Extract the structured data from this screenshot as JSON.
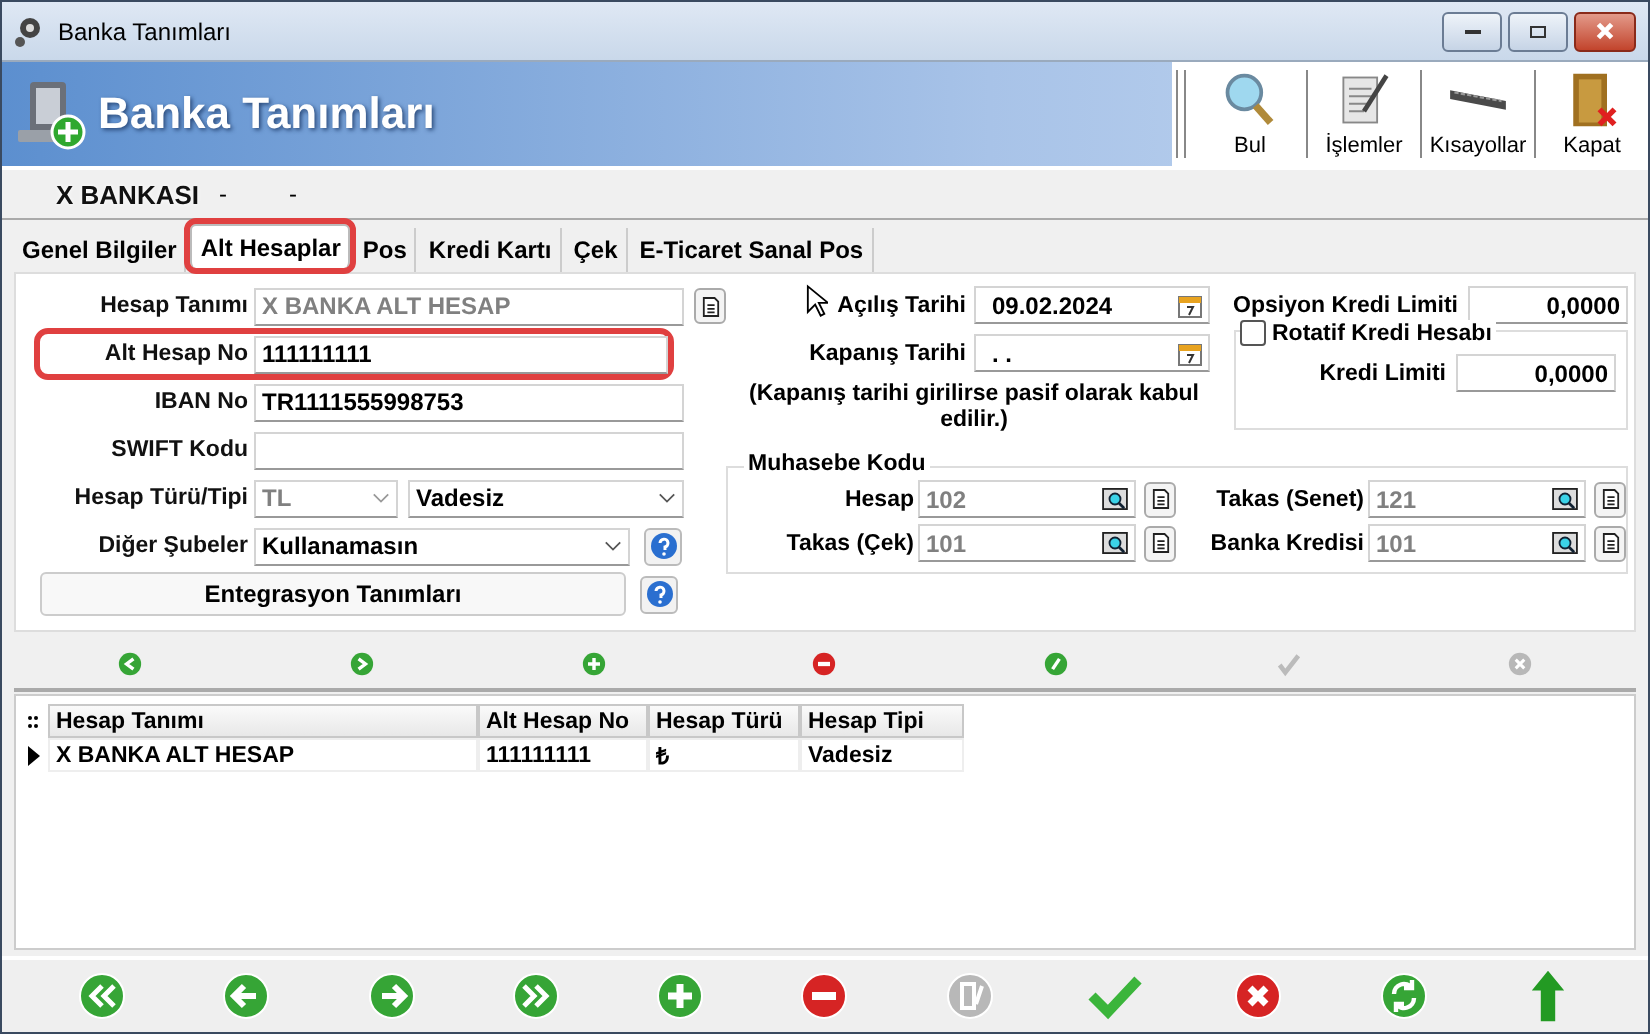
{
  "window": {
    "title": "Banka Tanımları"
  },
  "header": {
    "title": "Banka Tanımları",
    "tools": [
      {
        "kind": "search",
        "label": "Bul"
      },
      {
        "kind": "document",
        "label": "İşlemler"
      },
      {
        "kind": "keyboard",
        "label": "Kısayollar"
      },
      {
        "kind": "door",
        "label": "Kapat"
      }
    ]
  },
  "record": {
    "name": "X BANKASI",
    "field_2": "-",
    "field_3": "-"
  },
  "tabs": [
    {
      "label": "Genel Bilgiler",
      "selected": false,
      "highlighted": false
    },
    {
      "label": "Alt Hesaplar",
      "selected": true,
      "highlighted": true
    },
    {
      "label": "Pos",
      "selected": false,
      "highlighted": false
    },
    {
      "label": "Kredi Kartı",
      "selected": false,
      "highlighted": false
    },
    {
      "label": "Çek",
      "selected": false,
      "highlighted": false
    },
    {
      "label": "E-Ticaret Sanal Pos",
      "selected": false,
      "highlighted": false
    }
  ],
  "left_fields": [
    {
      "kind": "text",
      "label": "Hesap Tanımı",
      "value": "X BANKA ALT HESAP",
      "readonly": true,
      "doc_button": true,
      "highlighted": false
    },
    {
      "kind": "text",
      "label": "Alt Hesap No",
      "value": "111111111",
      "readonly": false,
      "doc_button": false,
      "highlighted": true
    },
    {
      "kind": "text",
      "label": "IBAN No",
      "value": "TR1111555998753",
      "readonly": false,
      "doc_button": false,
      "highlighted": false
    },
    {
      "kind": "text",
      "label": "SWIFT Kodu",
      "doc_button": false,
      "highlighted": false
    },
    {
      "kind": "pair",
      "label": "Hesap Türü/Tipi",
      "value": "TL",
      "value_2": "Vadesiz",
      "readonly": true
    },
    {
      "kind": "select",
      "label": "Diğer Şubeler",
      "value": "Kullanamasın"
    },
    {
      "kind": "button",
      "label": "Entegrasyon Tanımları"
    }
  ],
  "dates": [
    {
      "label": "Açılış Tarihi",
      "value": "09.02.2024"
    },
    {
      "label": "Kapanış Tarihi",
      "value": ". ."
    }
  ],
  "date_note": "(Kapanış tarihi girilirse pasif olarak kabul edilir.)",
  "credit": {
    "option_label": "Opsiyon Kredi Limiti",
    "option_value": "0,0000",
    "revolving": {
      "label": "Rotatif Kredi Hesabı",
      "checked": false
    },
    "limit_label": "Kredi Limiti",
    "limit_value": "0,0000"
  },
  "accounting": {
    "title": "Muhasebe Kodu",
    "codes": [
      {
        "label": "Hesap",
        "value": "102"
      },
      {
        "label": "Takas (Senet)",
        "value": "121"
      },
      {
        "label": "Takas (Çek)",
        "value": "101"
      },
      {
        "label": "Banka Kredisi",
        "value": "101"
      }
    ]
  },
  "mini_toolbar": [
    {
      "kind": "prev",
      "disabled": false
    },
    {
      "kind": "next",
      "disabled": false
    },
    {
      "kind": "add",
      "disabled": false
    },
    {
      "kind": "delete",
      "disabled": false
    },
    {
      "kind": "edit",
      "disabled": false
    },
    {
      "kind": "save",
      "disabled": true
    },
    {
      "kind": "cancel",
      "disabled": true
    }
  ],
  "grid": {
    "columns": [
      "Hesap Tanımı",
      "Alt Hesap No",
      "Hesap Türü",
      "Hesap Tipi"
    ],
    "rows": [
      {
        "selected": true,
        "cells": [
          "X BANKA ALT HESAP",
          "111111111",
          "₺",
          "Vadesiz"
        ]
      }
    ]
  },
  "bottom_toolbar": [
    {
      "kind": "first",
      "disabled": false
    },
    {
      "kind": "prev",
      "disabled": false
    },
    {
      "kind": "next",
      "disabled": false
    },
    {
      "kind": "last",
      "disabled": false
    },
    {
      "kind": "add",
      "disabled": false
    },
    {
      "kind": "delete",
      "disabled": false
    },
    {
      "kind": "edit",
      "disabled": true
    },
    {
      "kind": "save",
      "disabled": false
    },
    {
      "kind": "cancel",
      "disabled": false
    },
    {
      "kind": "refresh",
      "disabled": false
    },
    {
      "kind": "up",
      "disabled": false
    }
  ]
}
